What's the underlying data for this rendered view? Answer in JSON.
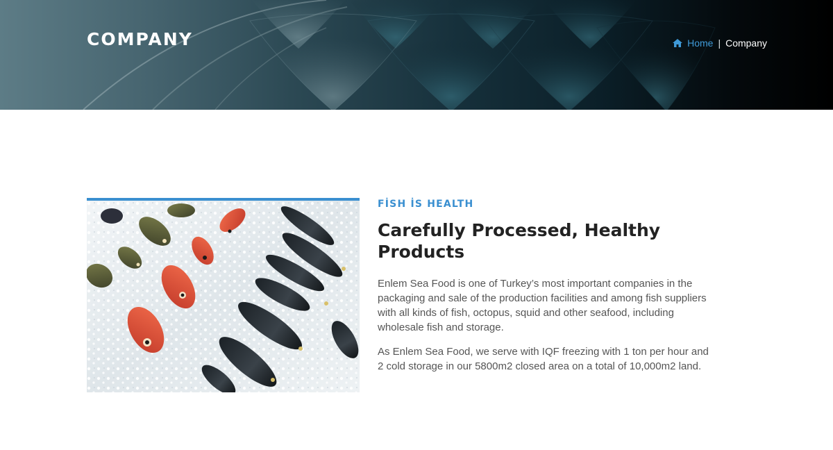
{
  "page_header": {
    "title": "COMPANY",
    "breadcrumb": {
      "home_icon": "home-icon",
      "home_label": "Home",
      "separator": "|",
      "current_label": "Company"
    }
  },
  "about": {
    "image_icon": "fish-on-ice-photo",
    "eyebrow": "FİSH İS HEALTH",
    "heading": "Carefully Processed, Healthy Products",
    "paragraphs": [
      "Enlem Sea Food is one of Turkey’s most important companies in the packaging and sale of the production facilities and among fish suppliers with all kinds of fish, octopus, squid and other seafood, including wholesale fish and storage.",
      "As Enlem Sea Food, we serve with IQF freezing with 1 ton per hour and 2 cold storage in our 5800m2 closed area on a total of 10,000m2 land."
    ]
  },
  "colors": {
    "accent": "#3a8fd0",
    "heading": "#222222",
    "body_text": "#555555"
  }
}
